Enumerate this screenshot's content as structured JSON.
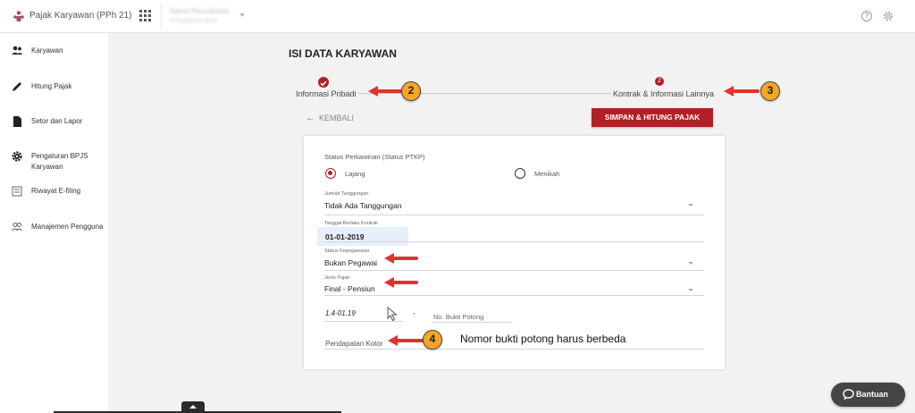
{
  "header": {
    "app_title": "Pajak Karyawan (PPh 21)",
    "company_name": "Nama Perusahaan",
    "company_sub": "Pengaturan Akun"
  },
  "sidebar": {
    "items": [
      {
        "label": "Karyawan",
        "icon": "users-icon"
      },
      {
        "label": "Hitung Pajak",
        "icon": "pencil-icon"
      },
      {
        "label": "Setor dan Lapor",
        "icon": "document-icon"
      },
      {
        "label": "Pengaturan BPJS Karyawan",
        "icon": "gear-icon"
      },
      {
        "label": "Riwayat E-filing",
        "icon": "history-icon"
      },
      {
        "label": "Manajemen Pengguna",
        "icon": "user-group-icon"
      }
    ]
  },
  "main": {
    "title": "ISI DATA KARYAWAN",
    "steps": [
      {
        "label": "Informasi Pribadi",
        "state": "completed"
      },
      {
        "label": "Kontrak & Informasi Lainnya",
        "number": "2",
        "state": "active"
      }
    ],
    "back_label": "KEMBALI",
    "save_label": "SIMPAN & HITUNG PAJAK"
  },
  "form": {
    "marital_label": "Status Perkawinan (Status PTKP)",
    "marital_options": [
      {
        "label": "Lajang",
        "selected": true
      },
      {
        "label": "Menikah",
        "selected": false
      }
    ],
    "dependents_label": "Jumlah Tanggungan",
    "dependents_value": "Tidak Ada Tanggungan",
    "contract_date_label": "Tanggal Berlaku Kontrak",
    "contract_date_value": "01-01-2019",
    "employment_label": "Status Kepegawaian",
    "employment_value": "Bukan Pegawai",
    "tax_type_label": "Jenis Pajak",
    "tax_type_value": "Final - Pensiun",
    "proof_prefix": "1.4-01.19",
    "proof_separator": "-",
    "proof_number_placeholder": "No. Bukti Potong",
    "gross_income_label": "Pendapatan Kotor"
  },
  "annotations": {
    "badges": [
      "2",
      "3",
      "4"
    ],
    "note": "Nomor bukti potong harus berbeda"
  },
  "help_button_label": "Bantuan",
  "colors": {
    "accent": "#b21f24",
    "badge": "#f5a623",
    "arrow": "#e0332d"
  }
}
